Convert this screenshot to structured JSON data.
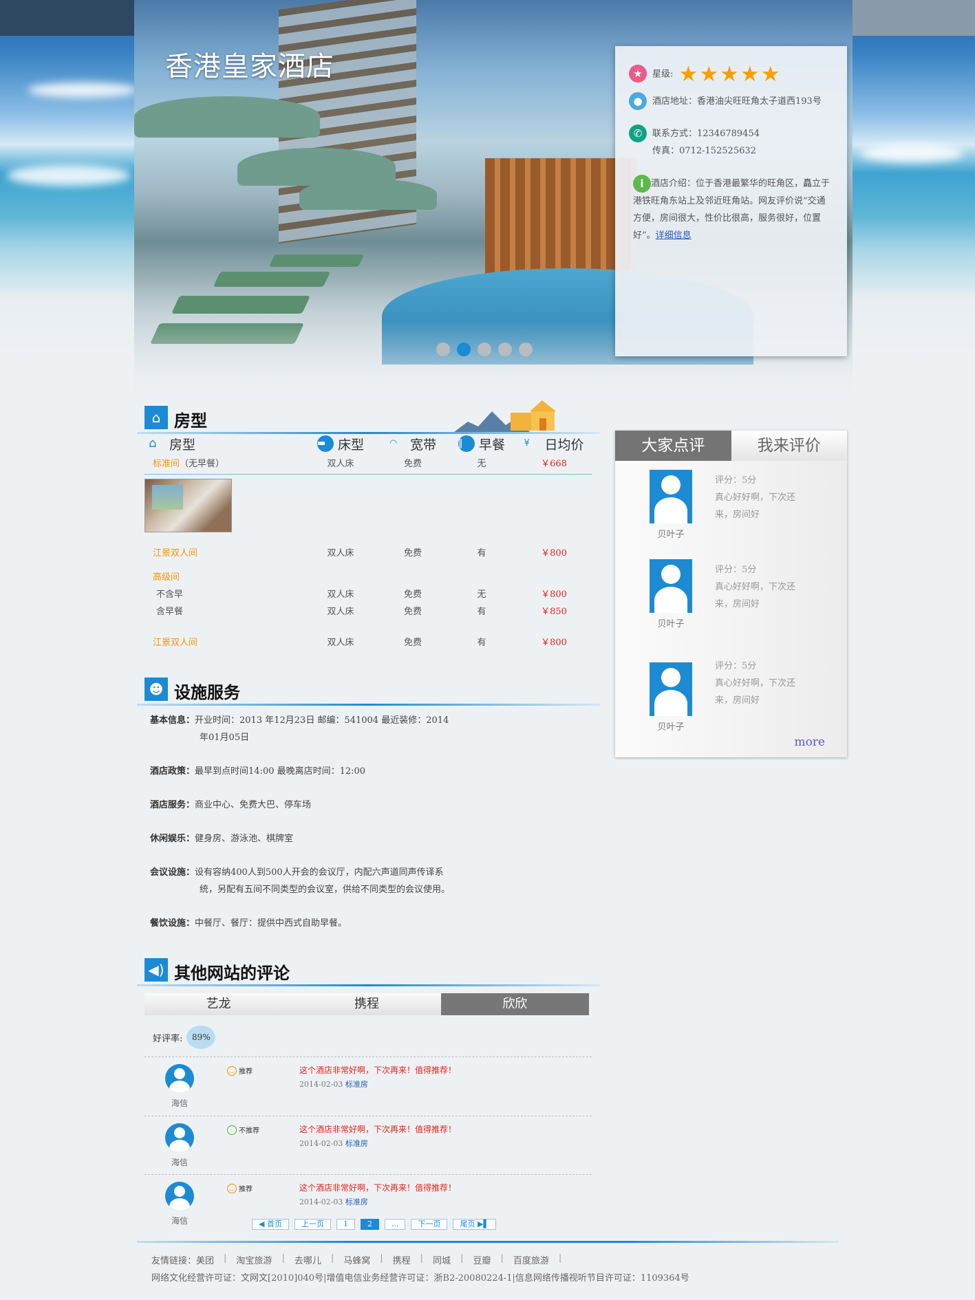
{
  "hotel": {
    "name": "香港皇家酒店",
    "star_label": "星级:",
    "star_count": 5,
    "address": "酒店地址：香港油尖旺旺角太子道西193号",
    "phone": "联系方式：12346789454",
    "fax": "传真：0712-152525632",
    "intro": "酒店介绍：位于香港最繁华的旺角区，矗立于港铁旺角东站上及邻近旺角站。网友评价说“交通方便，房间很大，性价比很高，服务很好，位置好”。",
    "detail_link": "详细信息"
  },
  "carousel": {
    "count": 5,
    "active_index": 1
  },
  "rooms": {
    "title": "房型",
    "headers": {
      "type": "房型",
      "bed": "床型",
      "wifi": "宽带",
      "breakfast": "早餐",
      "price": "日均价"
    },
    "std": {
      "name": "标准间",
      "note": "（无早餐）",
      "bed": "双人床",
      "wifi": "免费",
      "breakfast": "无",
      "price": "￥668"
    },
    "river1": {
      "name": "江景双人间",
      "bed": "双人床",
      "wifi": "免费",
      "breakfast": "有",
      "price": "￥800"
    },
    "premium": {
      "name": "高级间"
    },
    "premium_a": {
      "name": "不含早",
      "bed": "双人床",
      "wifi": "免费",
      "breakfast": "无",
      "price": "￥800"
    },
    "premium_b": {
      "name": "含早餐",
      "bed": "双人床",
      "wifi": "免费",
      "breakfast": "有",
      "price": "￥850"
    },
    "river2": {
      "name": "江景双人间",
      "bed": "双人床",
      "wifi": "免费",
      "breakfast": "有",
      "price": "￥800"
    }
  },
  "facilities": {
    "title": "设施服务",
    "basic_label": "基本信息：",
    "basic_value": "开业时间：2013 年12月23日  邮编：541004   最近装修：2014年01月05日",
    "policy_label": "酒店政策：",
    "policy_value": "最早到点时间14:00  最晚离店时间：12:00",
    "service_label": "酒店服务：",
    "service_value": "商业中心、免费大巴、停车场",
    "leisure_label": "休闲娱乐：",
    "leisure_value": "健身房、游泳池、棋牌室",
    "meeting_label": "会议设施：",
    "meeting_value": "设有容纳400人到500人开会的会议厅，内配六声道同声传译系统，另配有五间不同类型的会议室，供给不同类型的会议使用。",
    "dining_label": "餐饮设施：",
    "dining_value": "中餐厅、餐厅：提供中西式自助早餐。"
  },
  "other_reviews": {
    "title": "其他网站的评论",
    "tabs": [
      "艺龙",
      "携程",
      "欣欣"
    ],
    "active_tab": 2,
    "rate_label": "好评率:",
    "rate_value": "89%",
    "items": [
      {
        "user": "海信",
        "tag": "推荐",
        "text": "这个酒店非常好啊，下次再来！值得推荐！",
        "date": "2014-02-03",
        "room": "标准房"
      },
      {
        "user": "海信",
        "tag": "不推荐",
        "text": "这个酒店非常好啊，下次再来！值得推荐！",
        "date": "2014-02-03",
        "room": "标准房"
      },
      {
        "user": "海信",
        "tag": "推荐",
        "text": "这个酒店非常好啊，下次再来！值得推荐！",
        "date": "2014-02-03",
        "room": "标准房"
      }
    ]
  },
  "pager": {
    "first": "◀ 首页",
    "prev": "上一页",
    "p1": "1",
    "p2": "2",
    "ellipsis": "...",
    "next": "下一页",
    "last": "尾页 ▶▌"
  },
  "side_reviews": {
    "tab_all": "大家点评",
    "tab_mine": "我来评价",
    "items": [
      {
        "user": "贝叶子",
        "score": "评分：5分",
        "text": "真心好好啊，下次还来，房间好"
      },
      {
        "user": "贝叶子",
        "score": "评分：5分",
        "text": "真心好好啊，下次还来，房间好"
      },
      {
        "user": "贝叶子",
        "score": "评分：5分",
        "text": "真心好好啊，下次还来，房间好"
      }
    ],
    "more": "more"
  },
  "footer": {
    "links_label": "友情链接：",
    "links": [
      "美团",
      "淘宝旅游",
      "去哪儿",
      "马蜂窝",
      "携程",
      "同城",
      "豆瓣",
      "百度旅游"
    ],
    "copyright": "网络文化经营许可证：文网文[2010]040号|增值电信业务经营许可证：浙B2-20080224-1|信息网络传播视听节目许可证：1109364号"
  },
  "colors": {
    "accent": "#1c8bd4",
    "price": "#e2231a",
    "room_name": "#f29400",
    "star": "#f6a000"
  }
}
